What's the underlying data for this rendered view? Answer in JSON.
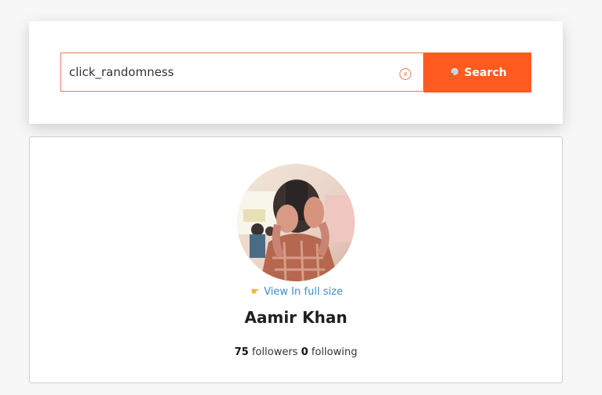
{
  "search": {
    "value": "click_randomness",
    "clear_label": "x",
    "button_label": "Search"
  },
  "profile": {
    "view_link_label": "View In full size",
    "name": "Aamir Khan",
    "followers_count": "75",
    "followers_label": "followers",
    "following_count": "0",
    "following_label": "following"
  },
  "colors": {
    "accent": "#ff5a1f",
    "border_accent": "#ef7a55",
    "link": "#3a8fc8"
  },
  "icons": {
    "search": "magnifier-icon",
    "clear": "clear-icon",
    "view": "pointing-hand-icon"
  }
}
